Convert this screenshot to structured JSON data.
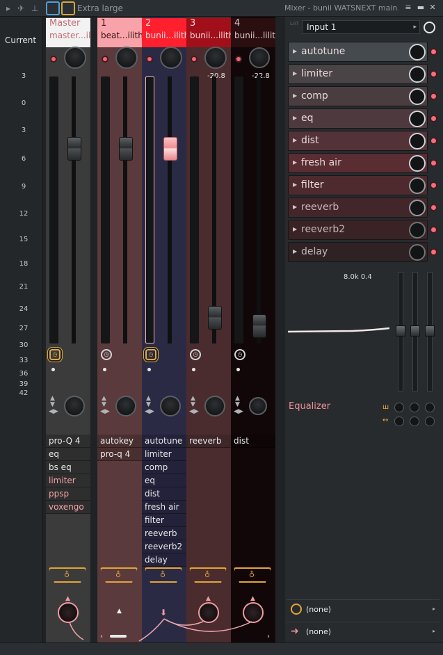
{
  "toolbar": {
    "size_label": "Extra large",
    "title": "Mixer - bunii WATSNEXT main..",
    "icons": [
      "play-arrow-icon",
      "bird-icon",
      "pin-icon",
      "strip-layout-icon",
      "docked-view-icon"
    ]
  },
  "scale": {
    "current_label": "Current",
    "marks": [
      "3",
      "0",
      "3",
      "6",
      "9",
      "12",
      "15",
      "18",
      "21",
      "24",
      "27",
      "30",
      "33",
      "36",
      "39",
      "42"
    ]
  },
  "strips": [
    {
      "id": "master",
      "num": "Master",
      "sub": "master...ilith",
      "db": "",
      "fx": [
        "pro-Q 4",
        "eq",
        "bs eq",
        "limiter",
        "ppsp",
        "voxengo"
      ],
      "fx_pink_from": 3
    },
    {
      "id": "track1",
      "num": "1",
      "sub": "beat...ilith",
      "db": "",
      "fx": [
        "autokey",
        "pro-q 4"
      ],
      "fx_pink_from": 99
    },
    {
      "id": "track2",
      "num": "2",
      "sub": "bunii...ilith",
      "db": "",
      "fx": [
        "autotune",
        "limiter",
        "comp",
        "eq",
        "dist",
        "fresh air",
        "filter",
        "reeverb",
        "reeverb2",
        "delay"
      ],
      "fx_pink_from": 99
    },
    {
      "id": "track3",
      "num": "3",
      "sub": "bunii...ilith",
      "db": "-20.8",
      "fx": [
        "reeverb"
      ],
      "fx_pink_from": 99
    },
    {
      "id": "track4",
      "num": "4",
      "sub": "bunii...lilith",
      "db": "-22.8",
      "fx": [
        "dist"
      ],
      "fx_pink_from": 99
    }
  ],
  "panel": {
    "input": "Input 1",
    "slots": [
      "autotune",
      "limiter",
      "comp",
      "eq",
      "dist",
      "fresh air",
      "filter",
      "reeverb",
      "reeverb2",
      "delay"
    ],
    "eq_readout": "8.0k 0.4",
    "eq_label": "Equalizer",
    "route_in": "(none)",
    "route_out": "(none)"
  },
  "colors": {
    "accent_pink": "#ef8f98",
    "accent_red": "#ff3341",
    "accent_yellow": "#e4a43a",
    "accent_blue": "#4ea0d4"
  }
}
